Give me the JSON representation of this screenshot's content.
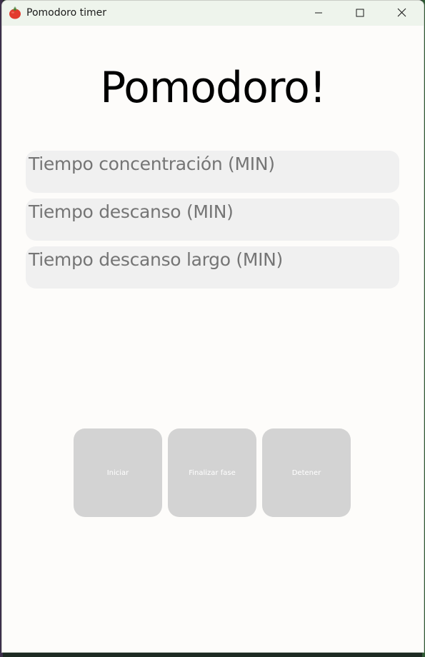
{
  "window": {
    "title": "Pomodoro timer",
    "app_icon": "tomato-icon",
    "controls": {
      "minimize_icon": "minimize-icon",
      "maximize_icon": "maximize-icon",
      "close_icon": "close-icon"
    }
  },
  "main": {
    "heading": "Pomodoro!",
    "fields": [
      {
        "placeholder": "Tiempo concentración (MIN)",
        "value": ""
      },
      {
        "placeholder": "Tiempo descanso (MIN)",
        "value": ""
      },
      {
        "placeholder": "Tiempo descanso largo (MIN)",
        "value": ""
      }
    ],
    "buttons": {
      "start": "Iniciar",
      "end_phase": "Finalizar fase",
      "stop": "Detener"
    }
  },
  "colors": {
    "titlebar": "#eef4ec",
    "background": "#fdfcfa",
    "field_bg": "#f0f0f0",
    "placeholder_text": "#757575",
    "button_bg": "#d3d3d3",
    "button_text": "#ffffff",
    "tomato": "#e23b2e"
  }
}
